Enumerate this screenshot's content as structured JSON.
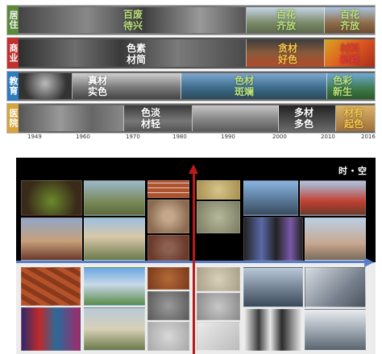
{
  "timeline": {
    "bands": [
      {
        "label": "居住",
        "label_bg": "#5a8a3a",
        "label_color": "#f0f0f0",
        "captions": [
          {
            "text": "百废\n待兴",
            "color": "#b9e07a"
          },
          {
            "text": "百花\n齐放",
            "color": "#b9e07a"
          },
          {
            "text": "百花\n齐放",
            "color": "#b9e07a"
          }
        ]
      },
      {
        "label": "商业",
        "label_bg": "#c23030",
        "label_color": "#ffffff",
        "captions": [
          {
            "text": "色素\n材简",
            "color": "#ffffff"
          },
          {
            "text": "贪材\n好色",
            "color": "#f4c64a"
          },
          {
            "text": "材料\n新颖",
            "color": "#e33a3a"
          }
        ]
      },
      {
        "label": "教育",
        "label_bg": "#2f7bbf",
        "label_color": "#ffffff",
        "captions": [
          {
            "text": "真材\n实色",
            "color": "#ffffff"
          },
          {
            "text": "色材\n斑斓",
            "color": "#b9e07a"
          },
          {
            "text": "色彩\n新生",
            "color": "#b9e07a"
          }
        ]
      },
      {
        "label": "医院",
        "label_bg": "#d6a43a",
        "label_color": "#ffffff",
        "captions": [
          {
            "text": "色淡\n材轻",
            "color": "#ffffff"
          },
          {
            "text": "多材\n多色",
            "color": "#ffffff"
          },
          {
            "text": "材有\n起色",
            "color": "#f4c64a"
          }
        ]
      }
    ],
    "years": [
      "1949",
      "1960",
      "1970",
      "1980",
      "1990",
      "2000",
      "2010",
      "2016"
    ]
  },
  "matrix": {
    "title": "时・空",
    "h_axis_color": "#5b7ec4",
    "v_axis_color": "#b81a1a"
  }
}
